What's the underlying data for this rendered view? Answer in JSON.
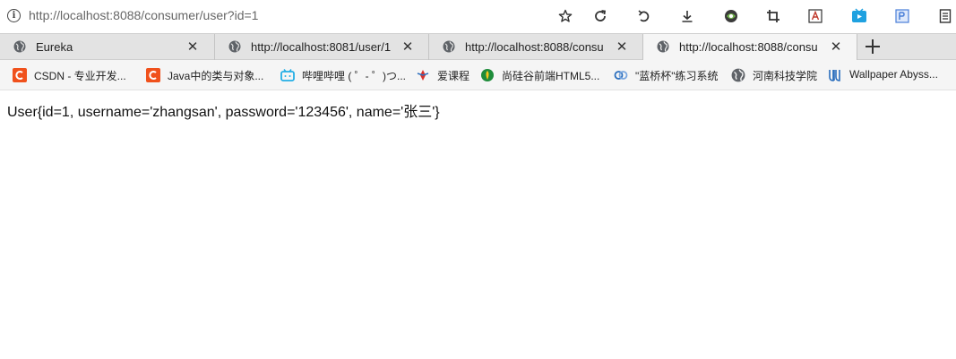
{
  "address_bar": {
    "url": "http://localhost:8088/consumer/user?id=1",
    "info_icon": "i"
  },
  "toolbar": {
    "icons": [
      "star-icon",
      "refresh-icon",
      "undo-icon",
      "download-icon",
      "extension-icon",
      "crop-icon",
      "translate-icon",
      "video-icon",
      "ext2-icon",
      "reader-icon"
    ]
  },
  "tabs": [
    {
      "title": "Eureka",
      "close": "✕",
      "active": false
    },
    {
      "title": "http://localhost:8081/user/1",
      "close": "✕",
      "active": false
    },
    {
      "title": "http://localhost:8088/consu",
      "close": "✕",
      "active": false
    },
    {
      "title": "http://localhost:8088/consu",
      "close": "✕",
      "active": true
    }
  ],
  "bookmarks": [
    {
      "label": "CSDN - 专业开发...",
      "icon": "csdn-icon",
      "color": "#f0511c"
    },
    {
      "label": "Java中的类与对象...",
      "icon": "csdn-icon",
      "color": "#f0511c"
    },
    {
      "label": "哔哩哔哩 ( ゜- ゜)つ...",
      "icon": "bilibili-icon",
      "color": "#23aee5"
    },
    {
      "label": "爱课程",
      "icon": "icourse-icon",
      "color": "#d9322c"
    },
    {
      "label": "尚硅谷前端HTML5...",
      "icon": "atguigu-icon",
      "color": "#1e8c3a"
    },
    {
      "label": "\"蓝桥杯\"练习系统",
      "icon": "lanqiao-icon",
      "color": "#2a6ebd"
    },
    {
      "label": "河南科技学院",
      "icon": "globe-icon",
      "color": "#555555"
    },
    {
      "label": "Wallpaper Abyss...",
      "icon": "wallpaper-icon",
      "color": "#2a6ebd"
    }
  ],
  "content": {
    "text": "User{id=1, username='zhangsan', password='123456', name='张三'}"
  }
}
